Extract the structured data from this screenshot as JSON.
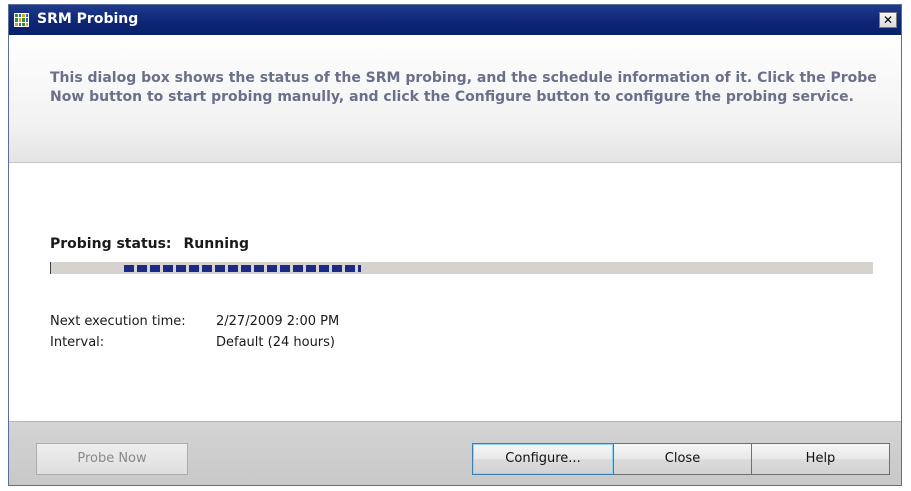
{
  "window": {
    "title": "SRM Probing",
    "close_glyph": "✕"
  },
  "header": {
    "description": "This dialog box shows the status of the SRM probing, and the schedule information of it. Click the Probe Now button to start probing manully, and click the Configure button to configure the probing service."
  },
  "status": {
    "label": "Probing status:",
    "value": "Running",
    "progress_style": "marquee"
  },
  "info": {
    "next_execution_label": "Next execution time:",
    "next_execution_value": "2/27/2009 2:00 PM",
    "interval_label": "Interval:",
    "interval_value": "Default (24 hours)"
  },
  "buttons": {
    "probe_now": "Probe Now",
    "configure": "Configure...",
    "close": "Close",
    "help": "Help"
  },
  "colors": {
    "titlebar": "#0c2574",
    "header_text": "#6a6f8a",
    "progress_block": "#1a2a86"
  }
}
